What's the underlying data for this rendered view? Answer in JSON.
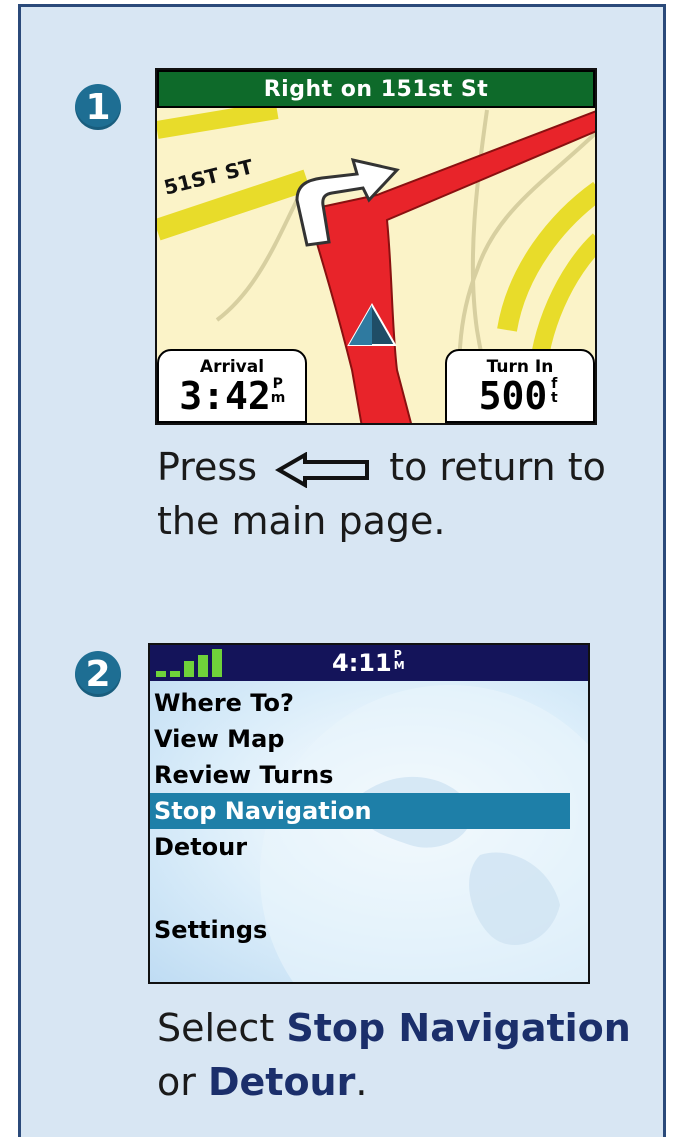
{
  "steps": {
    "one": "1",
    "two": "2"
  },
  "map": {
    "banner": "Right on 151st St",
    "street_label": "51ST ST",
    "arrival_label": "Arrival",
    "arrival_value": "3:42",
    "arrival_unit_top": "P",
    "arrival_unit_bottom": "m",
    "turn_label": "Turn In",
    "turn_value": "500",
    "turn_unit_top": "f",
    "turn_unit_bottom": "t"
  },
  "instruction1": {
    "pre": "Press",
    "post": "to return to",
    "line2": "the main page."
  },
  "menu": {
    "time": "4:11",
    "time_unit_top": "P",
    "time_unit_bottom": "M",
    "items": [
      "Where To?",
      "View Map",
      "Review Turns",
      "Stop Navigation",
      "Detour"
    ],
    "selected_index": 3,
    "settings": "Settings"
  },
  "instruction2": {
    "pre": "Select",
    "bold1": "Stop Navigation",
    "mid": "or",
    "bold2": "Detour",
    "end": "."
  },
  "colors": {
    "panel_bg": "#d8e6f3",
    "badge": "#1e6e93",
    "route": "#e8242a",
    "banner_green": "#0e6a2a",
    "menu_bar": "#14145a",
    "selected": "#1e7fa8",
    "bold_text": "#1b2f6b"
  }
}
